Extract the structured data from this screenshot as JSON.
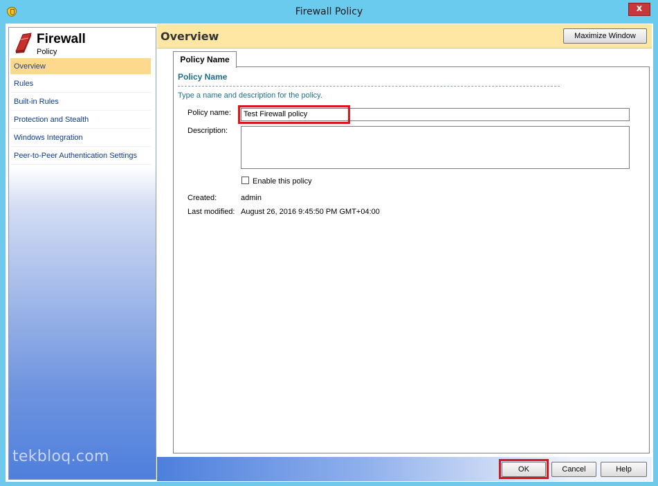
{
  "window": {
    "title": "Firewall Policy",
    "close_label": "x"
  },
  "brand": {
    "title": "Firewall",
    "subtitle": "Policy"
  },
  "nav": {
    "items": [
      {
        "label": "Overview",
        "active": true
      },
      {
        "label": "Rules"
      },
      {
        "label": "Built-in Rules"
      },
      {
        "label": "Protection and Stealth"
      },
      {
        "label": "Windows Integration"
      },
      {
        "label": "Peer-to-Peer Authentication Settings"
      }
    ]
  },
  "watermark": "tekbloq.com",
  "header": {
    "title": "Overview",
    "maximize_label": "Maximize Window"
  },
  "tab": {
    "label": "Policy Name"
  },
  "section": {
    "title": "Policy Name",
    "description": "Type a name and description for the policy."
  },
  "form": {
    "policy_name_label": "Policy name:",
    "policy_name_value": "Test Firewall policy",
    "description_label": "Description:",
    "description_value": "",
    "enable_label": "Enable this policy",
    "enable_checked": false,
    "created_label": "Created:",
    "created_value": "admin",
    "modified_label": "Last modified:",
    "modified_value": "August 26, 2016 9:45:50 PM GMT+04:00"
  },
  "footer": {
    "ok_label": "OK",
    "cancel_label": "Cancel",
    "help_label": "Help"
  },
  "colors": {
    "highlight": "#d9161c",
    "header_bg": "#fde7a3",
    "titlebar": "#6bcbee",
    "link": "#1c6f8c"
  }
}
